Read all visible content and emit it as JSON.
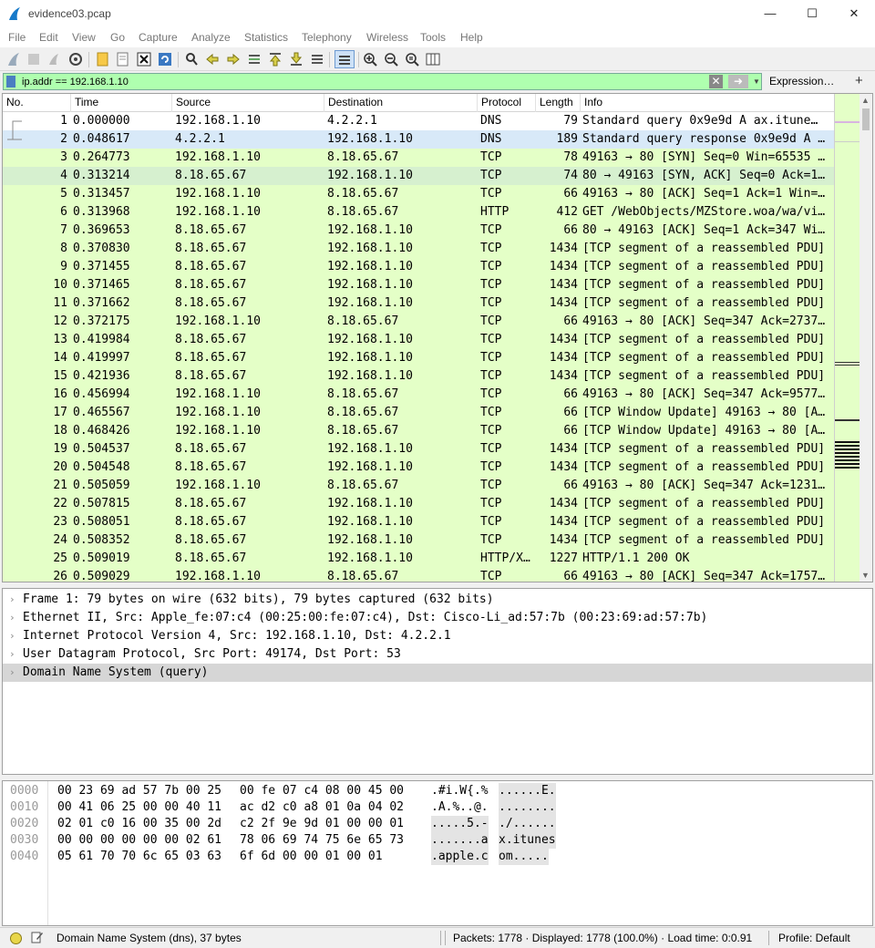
{
  "window": {
    "title": "evidence03.pcap"
  },
  "menu": [
    "File",
    "Edit",
    "View",
    "Go",
    "Capture",
    "Analyze",
    "Statistics",
    "Telephony",
    "Wireless",
    "Tools",
    "Help"
  ],
  "filter": {
    "value": "ip.addr == 192.168.1.10",
    "expression_label": "Expression…",
    "plus_label": "+"
  },
  "columns": [
    "No.",
    "Time",
    "Source",
    "Destination",
    "Protocol",
    "Length",
    "Info"
  ],
  "colors": {
    "dns_row": "#ffffff",
    "selected_row": "#d8e9f8",
    "tcp_row": "#e4ffc7",
    "http_row": "#e4ffc7",
    "selected_ack_row": "#d6f0cf",
    "filter_valid": "#afffaf"
  },
  "packets": [
    {
      "no": "1",
      "time": "0.000000",
      "src": "192.168.1.10",
      "dst": "4.2.2.1",
      "proto": "DNS",
      "len": "79",
      "info": "Standard query 0x9e9d A ax.itune…",
      "kind": "dns"
    },
    {
      "no": "2",
      "time": "0.048617",
      "src": "4.2.2.1",
      "dst": "192.168.1.10",
      "proto": "DNS",
      "len": "189",
      "info": "Standard query response 0x9e9d A …",
      "kind": "selected"
    },
    {
      "no": "3",
      "time": "0.264773",
      "src": "192.168.1.10",
      "dst": "8.18.65.67",
      "proto": "TCP",
      "len": "78",
      "info": "49163 → 80 [SYN] Seq=0 Win=65535 …",
      "kind": "tcp"
    },
    {
      "no": "4",
      "time": "0.313214",
      "src": "8.18.65.67",
      "dst": "192.168.1.10",
      "proto": "TCP",
      "len": "74",
      "info": "80 → 49163 [SYN, ACK] Seq=0 Ack=1…",
      "kind": "tcp_hl"
    },
    {
      "no": "5",
      "time": "0.313457",
      "src": "192.168.1.10",
      "dst": "8.18.65.67",
      "proto": "TCP",
      "len": "66",
      "info": "49163 → 80 [ACK] Seq=1 Ack=1 Win=…",
      "kind": "tcp"
    },
    {
      "no": "6",
      "time": "0.313968",
      "src": "192.168.1.10",
      "dst": "8.18.65.67",
      "proto": "HTTP",
      "len": "412",
      "info": "GET /WebObjects/MZStore.woa/wa/vi…",
      "kind": "tcp"
    },
    {
      "no": "7",
      "time": "0.369653",
      "src": "8.18.65.67",
      "dst": "192.168.1.10",
      "proto": "TCP",
      "len": "66",
      "info": "80 → 49163 [ACK] Seq=1 Ack=347 Wi…",
      "kind": "tcp"
    },
    {
      "no": "8",
      "time": "0.370830",
      "src": "8.18.65.67",
      "dst": "192.168.1.10",
      "proto": "TCP",
      "len": "1434",
      "info": "[TCP segment of a reassembled PDU]",
      "kind": "tcp"
    },
    {
      "no": "9",
      "time": "0.371455",
      "src": "8.18.65.67",
      "dst": "192.168.1.10",
      "proto": "TCP",
      "len": "1434",
      "info": "[TCP segment of a reassembled PDU]",
      "kind": "tcp"
    },
    {
      "no": "10",
      "time": "0.371465",
      "src": "8.18.65.67",
      "dst": "192.168.1.10",
      "proto": "TCP",
      "len": "1434",
      "info": "[TCP segment of a reassembled PDU]",
      "kind": "tcp"
    },
    {
      "no": "11",
      "time": "0.371662",
      "src": "8.18.65.67",
      "dst": "192.168.1.10",
      "proto": "TCP",
      "len": "1434",
      "info": "[TCP segment of a reassembled PDU]",
      "kind": "tcp"
    },
    {
      "no": "12",
      "time": "0.372175",
      "src": "192.168.1.10",
      "dst": "8.18.65.67",
      "proto": "TCP",
      "len": "66",
      "info": "49163 → 80 [ACK] Seq=347 Ack=2737…",
      "kind": "tcp"
    },
    {
      "no": "13",
      "time": "0.419984",
      "src": "8.18.65.67",
      "dst": "192.168.1.10",
      "proto": "TCP",
      "len": "1434",
      "info": "[TCP segment of a reassembled PDU]",
      "kind": "tcp"
    },
    {
      "no": "14",
      "time": "0.419997",
      "src": "8.18.65.67",
      "dst": "192.168.1.10",
      "proto": "TCP",
      "len": "1434",
      "info": "[TCP segment of a reassembled PDU]",
      "kind": "tcp"
    },
    {
      "no": "15",
      "time": "0.421936",
      "src": "8.18.65.67",
      "dst": "192.168.1.10",
      "proto": "TCP",
      "len": "1434",
      "info": "[TCP segment of a reassembled PDU]",
      "kind": "tcp"
    },
    {
      "no": "16",
      "time": "0.456994",
      "src": "192.168.1.10",
      "dst": "8.18.65.67",
      "proto": "TCP",
      "len": "66",
      "info": "49163 → 80 [ACK] Seq=347 Ack=9577…",
      "kind": "tcp"
    },
    {
      "no": "17",
      "time": "0.465567",
      "src": "192.168.1.10",
      "dst": "8.18.65.67",
      "proto": "TCP",
      "len": "66",
      "info": "[TCP Window Update] 49163 → 80 [A…",
      "kind": "tcp"
    },
    {
      "no": "18",
      "time": "0.468426",
      "src": "192.168.1.10",
      "dst": "8.18.65.67",
      "proto": "TCP",
      "len": "66",
      "info": "[TCP Window Update] 49163 → 80 [A…",
      "kind": "tcp"
    },
    {
      "no": "19",
      "time": "0.504537",
      "src": "8.18.65.67",
      "dst": "192.168.1.10",
      "proto": "TCP",
      "len": "1434",
      "info": "[TCP segment of a reassembled PDU]",
      "kind": "tcp"
    },
    {
      "no": "20",
      "time": "0.504548",
      "src": "8.18.65.67",
      "dst": "192.168.1.10",
      "proto": "TCP",
      "len": "1434",
      "info": "[TCP segment of a reassembled PDU]",
      "kind": "tcp"
    },
    {
      "no": "21",
      "time": "0.505059",
      "src": "192.168.1.10",
      "dst": "8.18.65.67",
      "proto": "TCP",
      "len": "66",
      "info": "49163 → 80 [ACK] Seq=347 Ack=1231…",
      "kind": "tcp"
    },
    {
      "no": "22",
      "time": "0.507815",
      "src": "8.18.65.67",
      "dst": "192.168.1.10",
      "proto": "TCP",
      "len": "1434",
      "info": "[TCP segment of a reassembled PDU]",
      "kind": "tcp"
    },
    {
      "no": "23",
      "time": "0.508051",
      "src": "8.18.65.67",
      "dst": "192.168.1.10",
      "proto": "TCP",
      "len": "1434",
      "info": "[TCP segment of a reassembled PDU]",
      "kind": "tcp"
    },
    {
      "no": "24",
      "time": "0.508352",
      "src": "8.18.65.67",
      "dst": "192.168.1.10",
      "proto": "TCP",
      "len": "1434",
      "info": "[TCP segment of a reassembled PDU]",
      "kind": "tcp"
    },
    {
      "no": "25",
      "time": "0.509019",
      "src": "8.18.65.67",
      "dst": "192.168.1.10",
      "proto": "HTTP/X…",
      "len": "1227",
      "info": "HTTP/1.1 200 OK",
      "kind": "tcp"
    },
    {
      "no": "26",
      "time": "0.509029",
      "src": "192.168.1.10",
      "dst": "8.18.65.67",
      "proto": "TCP",
      "len": "66",
      "info": "49163 → 80 [ACK] Seq=347 Ack=1757…",
      "kind": "tcp"
    }
  ],
  "details": [
    {
      "text": "Frame 1: 79 bytes on wire (632 bits), 79 bytes captured (632 bits)",
      "selected": false
    },
    {
      "text": "Ethernet II, Src: Apple_fe:07:c4 (00:25:00:fe:07:c4), Dst: Cisco-Li_ad:57:7b (00:23:69:ad:57:7b)",
      "selected": false
    },
    {
      "text": "Internet Protocol Version 4, Src: 192.168.1.10, Dst: 4.2.2.1",
      "selected": false
    },
    {
      "text": "User Datagram Protocol, Src Port: 49174, Dst Port: 53",
      "selected": false
    },
    {
      "text": "Domain Name System (query)",
      "selected": true
    }
  ],
  "bytes": [
    {
      "offset": "0000",
      "hex1": "00 23 69 ad 57 7b 00 25",
      "hex2": "00 fe 07 c4 08 00 45 00",
      "ascii1": ".#i.W{.%",
      "ascii2": "......E."
    },
    {
      "offset": "0010",
      "hex1": "00 41 06 25 00 00 40 11",
      "hex2": "ac d2 c0 a8 01 0a 04 02",
      "ascii1": ".A.%..@.",
      "ascii2": "........"
    },
    {
      "offset": "0020",
      "hex1": "02 01 c0 16 00 35 00 2d",
      "hex2": "c2 2f 9e 9d 01 00 00 01",
      "ascii1": ".....5.-",
      "ascii2": "./......"
    },
    {
      "offset": "0030",
      "hex1": "00 00 00 00 00 00 02 61",
      "hex2": "78 06 69 74 75 6e 65 73",
      "ascii1": ".......a",
      "ascii2": "x.itunes"
    },
    {
      "offset": "0040",
      "hex1": "05 61 70 70 6c 65 03 63",
      "hex2": "6f 6d 00 00 01 00 01",
      "ascii1": ".apple.c",
      "ascii2": "om....."
    }
  ],
  "status": {
    "field_info": "Domain Name System (dns), 37 bytes",
    "packets_info": "Packets: 1778 · Displayed: 1778 (100.0%) · Load time: 0:0.91",
    "profile": "Profile: Default"
  }
}
